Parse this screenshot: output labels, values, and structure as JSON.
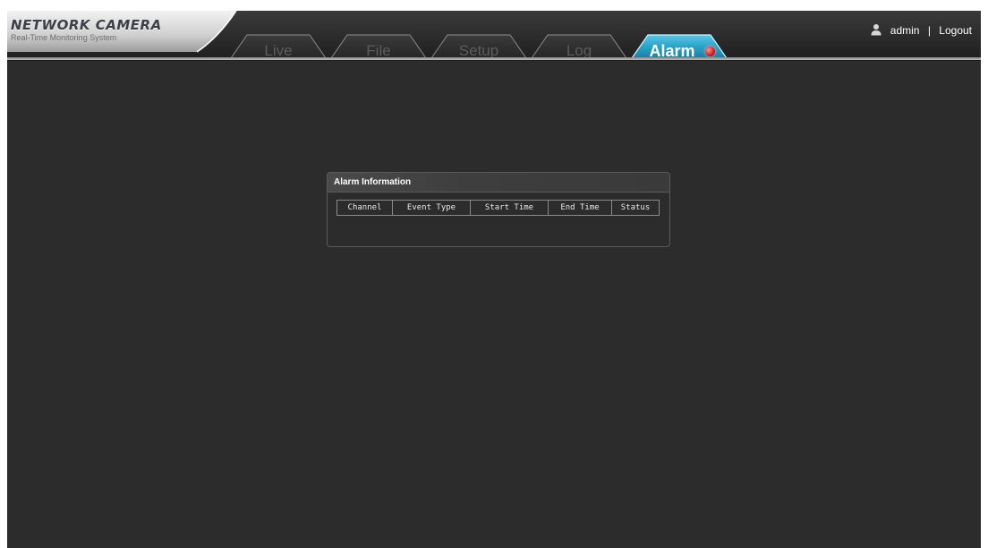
{
  "app": {
    "title": "NETWORK CAMERA",
    "subtitle": "Real-Time Monitoring System"
  },
  "nav": {
    "tabs": [
      {
        "label": "Live",
        "active": false
      },
      {
        "label": "File",
        "active": false
      },
      {
        "label": "Setup",
        "active": false
      },
      {
        "label": "Log",
        "active": false
      },
      {
        "label": "Alarm",
        "active": true
      }
    ],
    "alarm_indicator_icon": "red-dot-icon"
  },
  "user": {
    "icon": "user-icon",
    "name": "admin",
    "separator": "|",
    "logout_label": "Logout"
  },
  "alarm_panel": {
    "title": "Alarm Information",
    "columns": [
      "Channel",
      "Event Type",
      "Start Time",
      "End Time",
      "Status"
    ],
    "rows": []
  },
  "colors": {
    "background": "#2c2c2c",
    "active_tab": "#2aa3c9",
    "alarm_dot": "#e02020"
  }
}
